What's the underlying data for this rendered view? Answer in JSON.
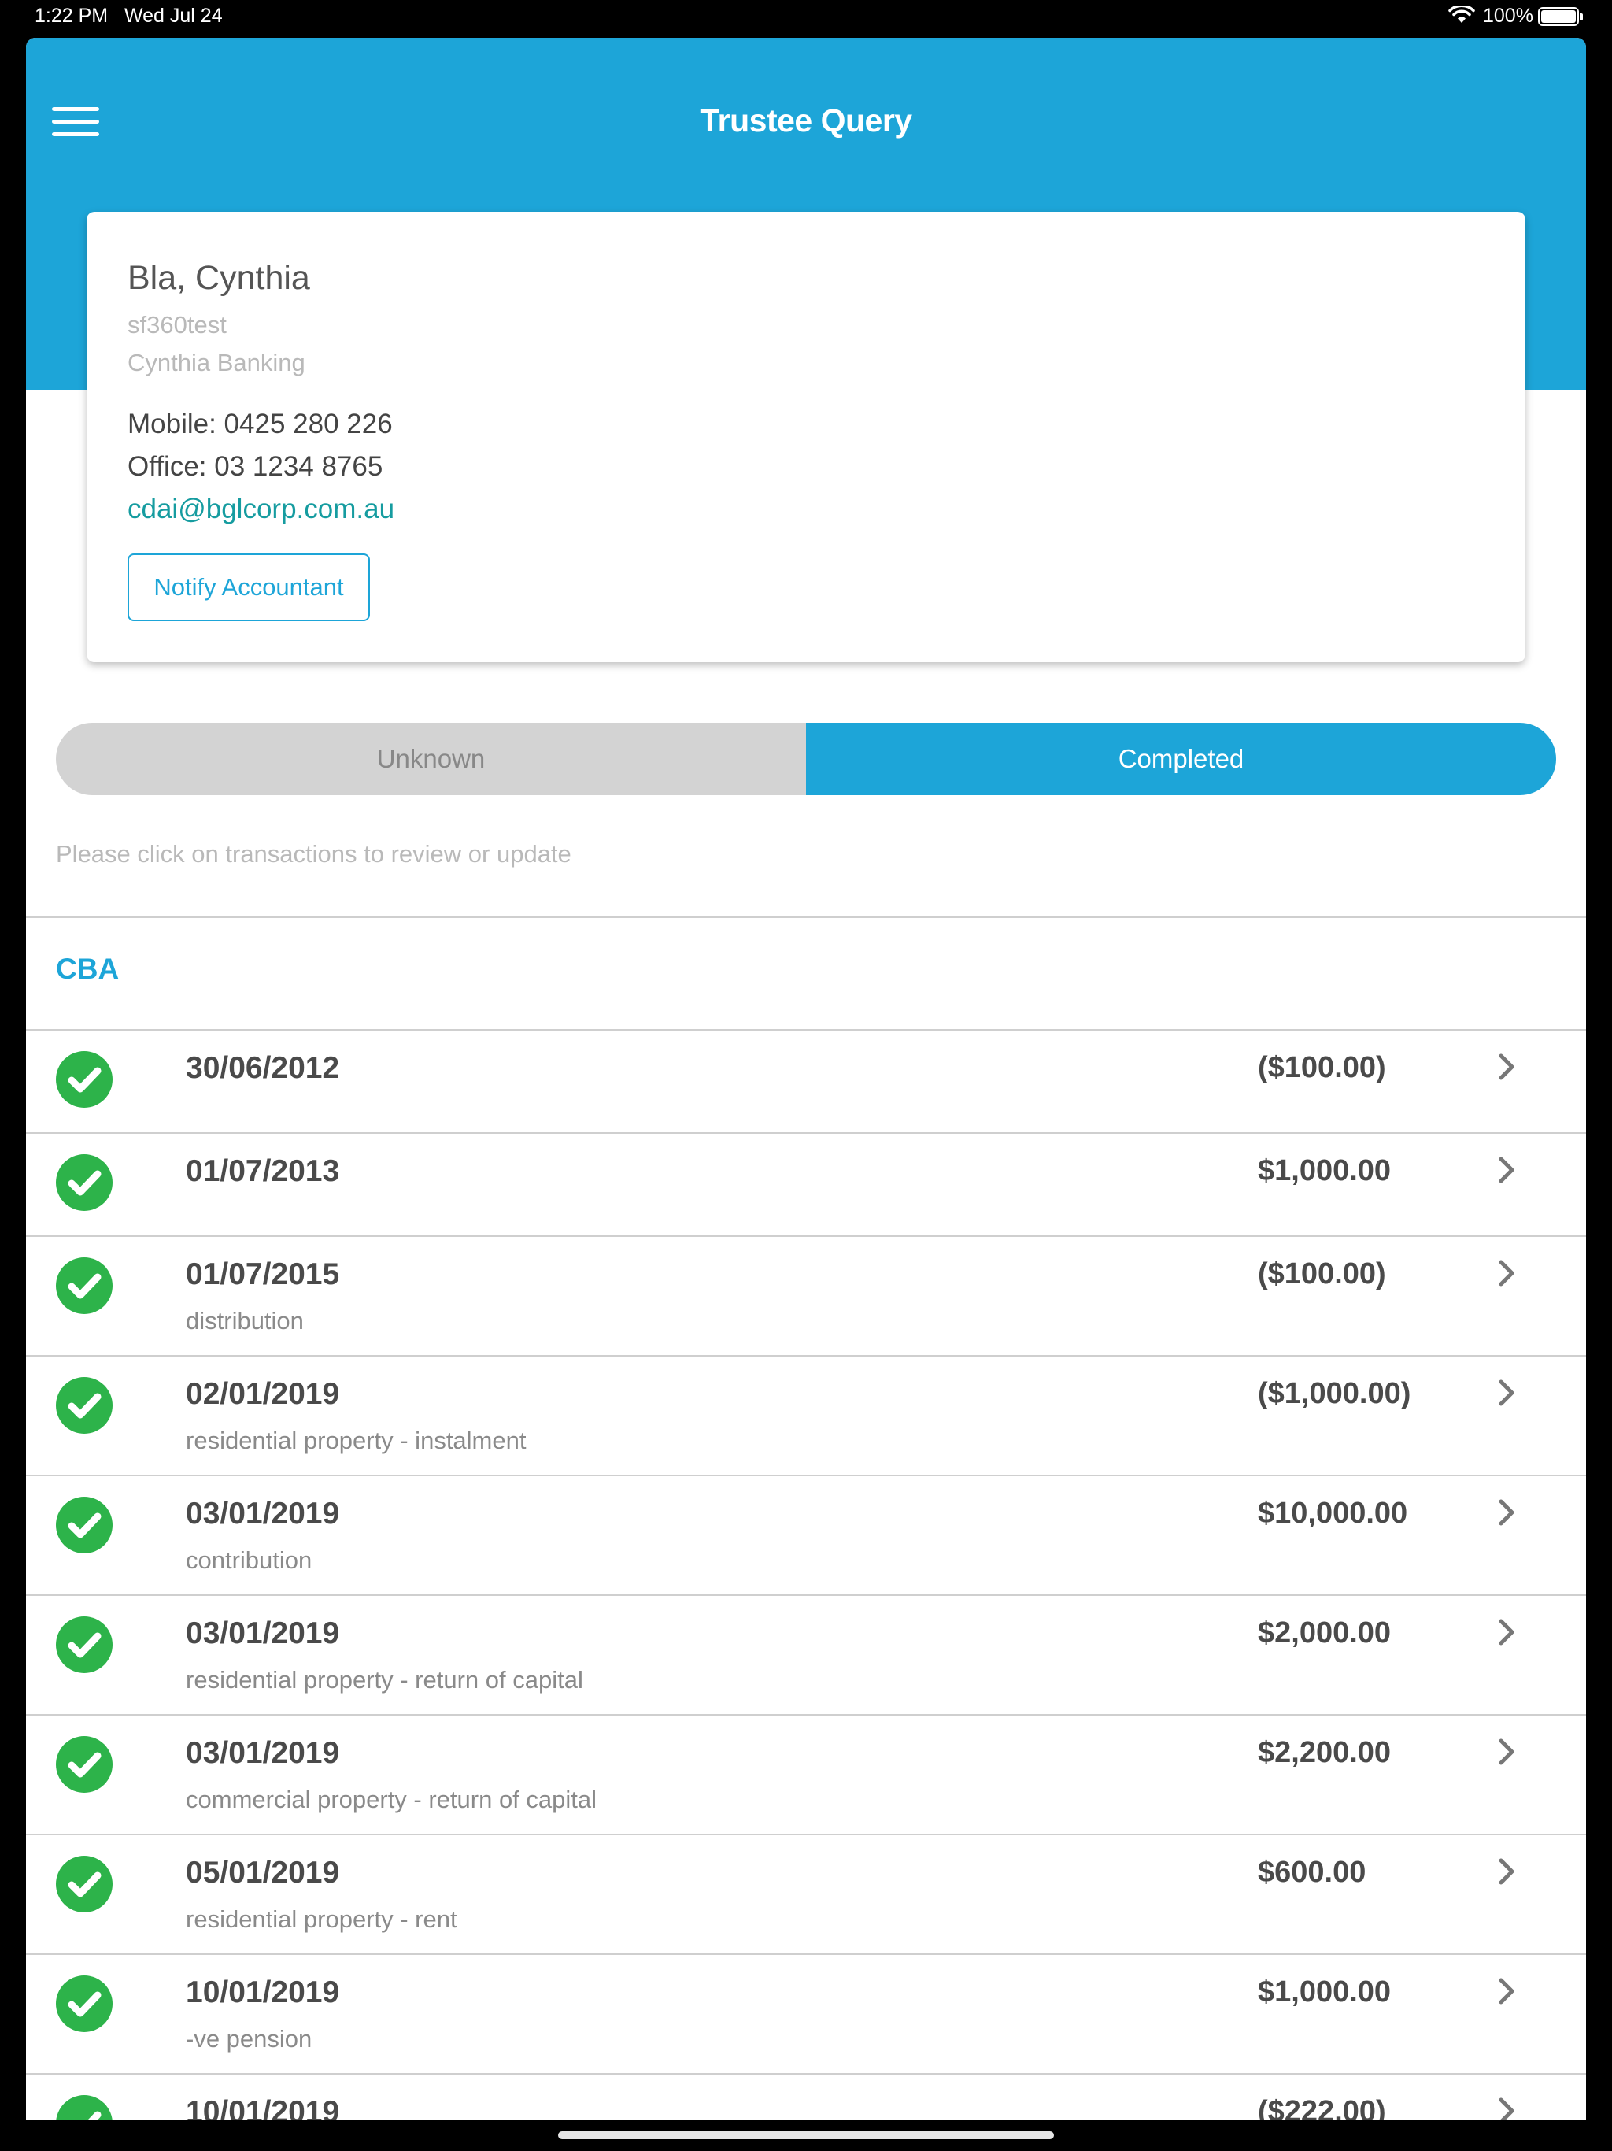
{
  "status_bar": {
    "time": "1:22 PM",
    "date": "Wed Jul 24",
    "battery": "100%"
  },
  "header": {
    "title": "Trustee Query"
  },
  "contact": {
    "name": "Bla, Cynthia",
    "username": "sf360test",
    "bank": "Cynthia Banking",
    "mobile": "Mobile: 0425 280 226",
    "office": "Office: 03 1234 8765",
    "email": "cdai@bglcorp.com.au",
    "notify_label": "Notify Accountant"
  },
  "segment": {
    "unknown": "Unknown",
    "completed": "Completed",
    "selected": "Completed"
  },
  "hint": "Please click on transactions to review or update",
  "section": "CBA",
  "transactions": [
    {
      "date": "30/06/2012",
      "desc": "",
      "amount": "($100.00)"
    },
    {
      "date": "01/07/2013",
      "desc": "",
      "amount": "$1,000.00"
    },
    {
      "date": "01/07/2015",
      "desc": "distribution",
      "amount": "($100.00)"
    },
    {
      "date": "02/01/2019",
      "desc": "residential property - instalment",
      "amount": "($1,000.00)"
    },
    {
      "date": "03/01/2019",
      "desc": "contribution",
      "amount": "$10,000.00"
    },
    {
      "date": "03/01/2019",
      "desc": "residential property - return of capital",
      "amount": "$2,000.00"
    },
    {
      "date": "03/01/2019",
      "desc": "commercial property - return of capital",
      "amount": "$2,200.00"
    },
    {
      "date": "05/01/2019",
      "desc": "residential property - rent",
      "amount": "$600.00"
    },
    {
      "date": "10/01/2019",
      "desc": "-ve pension",
      "amount": "$1,000.00"
    },
    {
      "date": "10/01/2019",
      "desc": "",
      "amount": "($222.00)"
    }
  ],
  "colors": {
    "accent": "#1da5d8",
    "check": "#2db34a",
    "email": "#169ca0"
  },
  "icons": {
    "menu": "hamburger-menu-icon",
    "status": "check-circle-icon",
    "row_action": "chevron-right-icon"
  }
}
